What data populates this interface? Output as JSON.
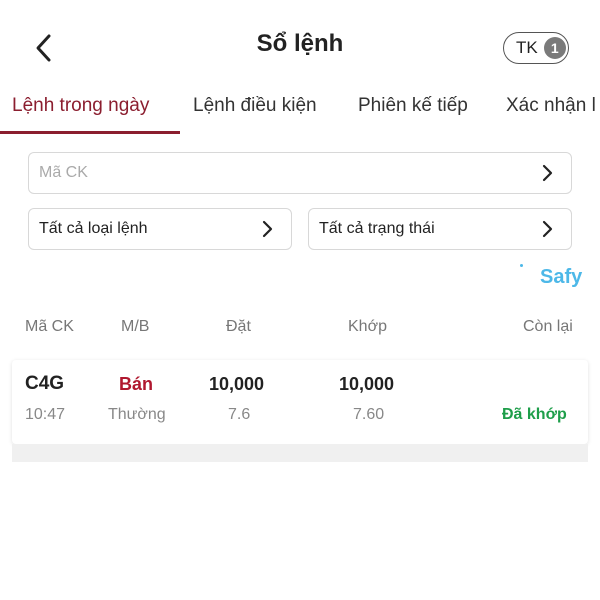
{
  "header": {
    "title": "Sổ lệnh",
    "account_label": "TK",
    "account_count": "1"
  },
  "tabs": [
    {
      "label": "Lệnh trong ngày",
      "active": true
    },
    {
      "label": "Lệnh điều kiện",
      "active": false
    },
    {
      "label": "Phiên kế tiếp",
      "active": false
    },
    {
      "label": "Xác nhận l",
      "active": false
    }
  ],
  "filters": {
    "symbol_placeholder": "Mã CK",
    "order_type": "Tất cả loại lệnh",
    "status": "Tất cả trạng thái"
  },
  "brand": "Safy",
  "table": {
    "columns": [
      "Mã CK",
      "M/B",
      "Đặt",
      "Khớp",
      "Còn lại"
    ],
    "rows": [
      {
        "symbol": "C4G",
        "time": "10:47",
        "side": "Bán",
        "order_kind": "Thường",
        "placed_qty": "10,000",
        "placed_price": "7.6",
        "matched_qty": "10,000",
        "matched_price": "7.60",
        "remaining": "",
        "status": "Đã khớp"
      }
    ]
  },
  "colors": {
    "accent": "#8b1e2f",
    "sell": "#b0182f",
    "matched": "#1e9e4a",
    "brand": "#4db8e8"
  },
  "icons": {
    "back": "chevron-left-icon",
    "field_arrow": "chevron-right-icon"
  }
}
